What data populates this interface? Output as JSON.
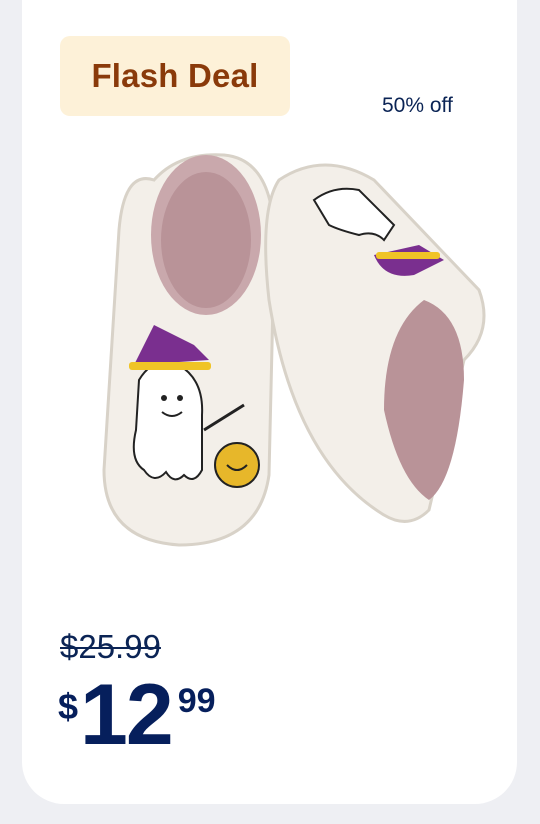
{
  "badge": {
    "label": "Flash Deal"
  },
  "discount": {
    "label": "50% off"
  },
  "pricing": {
    "original": "$25.99",
    "currency": "$",
    "whole": "12",
    "cents": "99"
  },
  "product": {
    "image_alt": "slippers-with-ghost-embroidery"
  },
  "colors": {
    "background": "#eeeff3",
    "card": "#ffffff",
    "badge_bg": "#fdf1d8",
    "badge_text": "#8a3a0a",
    "price_text": "#061f5c"
  }
}
